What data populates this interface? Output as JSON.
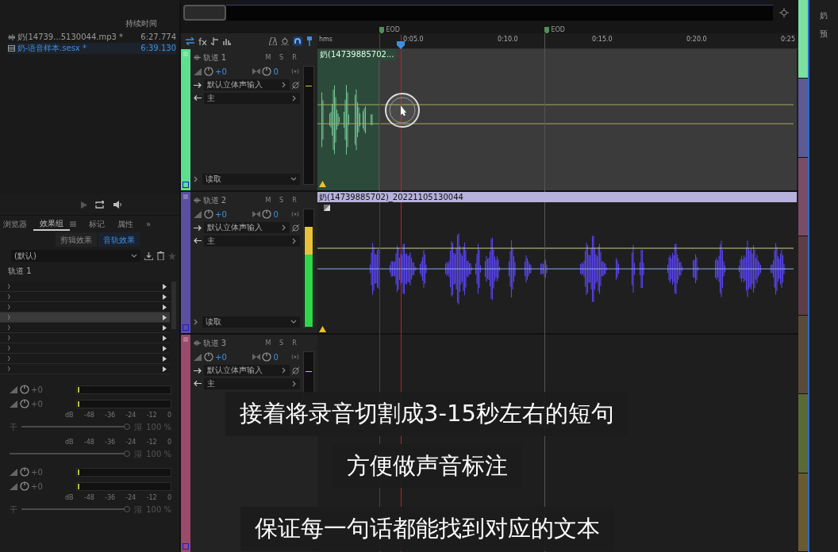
{
  "files_panel": {
    "column_header": "持续时间",
    "files": [
      {
        "kind": "audio",
        "name": "奶(14739...5130044.mp3 *",
        "duration": "6:27.774",
        "selected": false
      },
      {
        "kind": "session",
        "name": "奶-语音样本.sesx *",
        "duration": "6:39.130",
        "selected": true
      }
    ]
  },
  "effects_panel": {
    "tabs": [
      {
        "label": "浏览器",
        "selected": false
      },
      {
        "label": "效果组",
        "selected": true
      },
      {
        "label": "标记",
        "selected": false
      },
      {
        "label": "属性",
        "selected": false
      }
    ],
    "overflow": "»",
    "subtabs": [
      {
        "label": "剪辑效果",
        "selected": false
      },
      {
        "label": "音轨效果",
        "selected": true
      }
    ],
    "preset": "(默认)",
    "track_label": "轨道 1",
    "rack_rows": [
      {
        "selected": false
      },
      {
        "selected": false
      },
      {
        "selected": false
      },
      {
        "selected": true
      },
      {
        "selected": false
      },
      {
        "selected": false
      },
      {
        "selected": false
      },
      {
        "selected": false
      },
      {
        "selected": false
      }
    ],
    "meter_blocks": [
      {
        "rows": [
          "+0",
          "+0"
        ],
        "scale": [
          "dB",
          "-48",
          "-36",
          "-24",
          "-12",
          "0"
        ],
        "dry": "干",
        "level": 1,
        "wet": "湿",
        "mix": "100 %"
      },
      {
        "scale": [
          "dB",
          "-48",
          "-36",
          "-24",
          "-12",
          "0"
        ],
        "level": 1,
        "wet": "湿",
        "mix": "100 %"
      },
      {
        "rows": [
          "+0",
          "+0"
        ],
        "scale": [
          "dB",
          "-48",
          "-36",
          "-24",
          "-12",
          "0"
        ],
        "dry": "干",
        "level": 1,
        "wet": "湿",
        "mix": "100 %"
      }
    ]
  },
  "editor": {
    "markers": [
      "EOD",
      "EOD"
    ],
    "ruler": {
      "unit": "hms",
      "ticks": [
        "0:05.0",
        "0:10.0",
        "0:15.0",
        "0:20.0",
        "0:25"
      ]
    },
    "tracks": [
      {
        "name": "轨道 1",
        "color": "#5ce08f",
        "buttons": [
          "M",
          "S",
          "R"
        ],
        "volume": "+0",
        "pan": "0",
        "input": "默认立体声输入",
        "output": "主",
        "automation": "读取",
        "level": 0,
        "clip": {
          "kind": "short",
          "label": "奶(14739885702..."
        }
      },
      {
        "name": "轨道 2",
        "color": "#5a4fa0",
        "buttons": [
          "M",
          "S",
          "R"
        ],
        "volume": "+0",
        "pan": "0",
        "input": "默认立体声输入",
        "output": "主",
        "automation": "读取",
        "level": 0.85,
        "clip": {
          "kind": "long",
          "label": "奶(14739885702)_20221105130044"
        }
      },
      {
        "name": "轨道 3",
        "color": "#9a4a6a",
        "buttons": [
          "M",
          "S",
          "R"
        ],
        "volume": "+0",
        "pan": "0",
        "input": "默认立体声输入",
        "output": "主",
        "level": 0
      }
    ]
  },
  "side_panel": {
    "labels": [
      "奶",
      "预"
    ]
  },
  "subtitles": [
    "接着将录音切割成3-15秒左右的短句",
    "方便做声音标注",
    "保证每一句话都能找到对应的文本"
  ]
}
